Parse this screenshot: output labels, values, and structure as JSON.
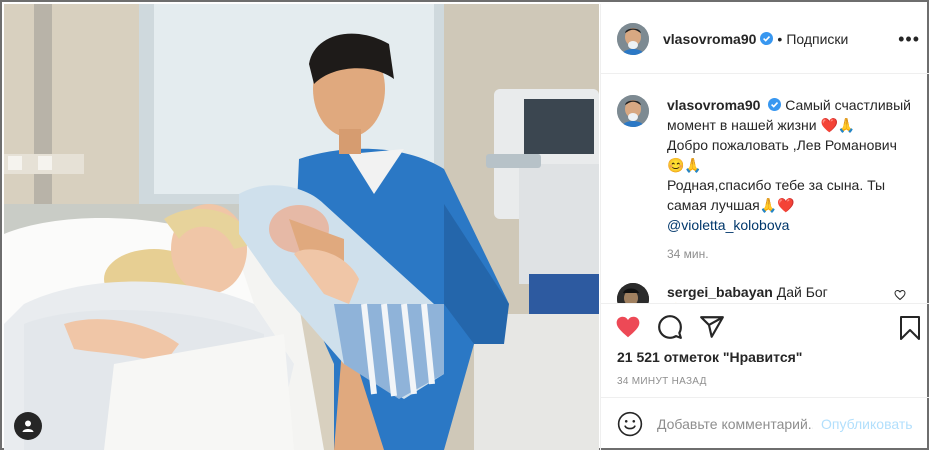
{
  "post": {
    "photo_alt": "",
    "username": "vlasovroma90",
    "separator": "•",
    "follow_label": "Подписки",
    "more_label": "•••"
  },
  "caption": {
    "username": "vlasovroma90",
    "line1": "Самый счастливый момент в нашей жизни",
    "emoji1": "❤️🙏",
    "line2": "Добро пожаловать ,Лев Романович",
    "emoji2": "😊🙏",
    "line3": "Родная,спасибо тебе за сына. Ты самая лучшая",
    "emoji3": "🙏❤️",
    "mention": "@violetta_kolobova",
    "time": "34 мин."
  },
  "comment": {
    "username": "sergei_babayan",
    "text": "Дай Бог",
    "emoji": "😊🙏🙏🙏"
  },
  "actions": {
    "likes": "21 521 отметок \"Нравится\"",
    "post_date": "34 МИНУТ НАЗАД"
  },
  "add_comment": {
    "placeholder": "Добавьте комментарий...",
    "publish_label": "Опубликовать"
  },
  "colors": {
    "like_red": "#ed4956",
    "verified_blue": "#3897f0",
    "publish_disabled": "#b2dffc",
    "text_primary": "#262626",
    "text_secondary": "#8e8e8e"
  },
  "icons": [
    "verified-icon",
    "more-icon",
    "like-icon",
    "comment-icon",
    "share-icon",
    "save-icon",
    "smile-icon",
    "user-tag-icon",
    "comment-like-icon"
  ]
}
